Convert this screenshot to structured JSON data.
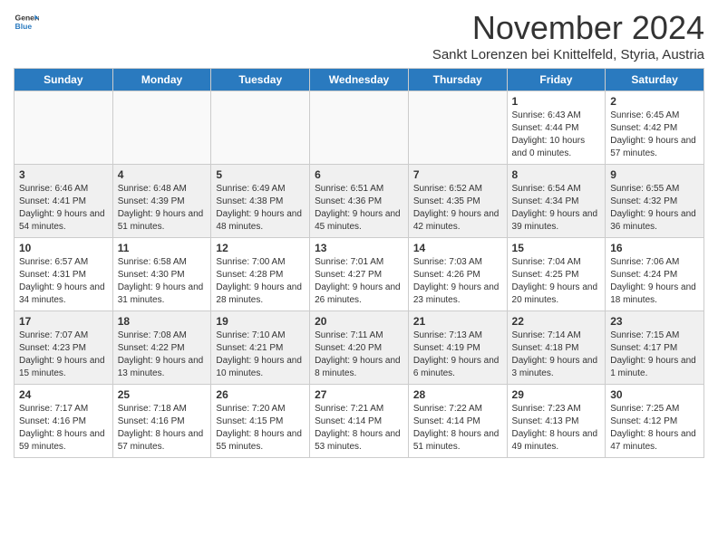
{
  "header": {
    "logo_line1": "General",
    "logo_line2": "Blue",
    "month_title": "November 2024",
    "location": "Sankt Lorenzen bei Knittelfeld, Styria, Austria"
  },
  "days_of_week": [
    "Sunday",
    "Monday",
    "Tuesday",
    "Wednesday",
    "Thursday",
    "Friday",
    "Saturday"
  ],
  "weeks": [
    [
      {
        "day": "",
        "info": ""
      },
      {
        "day": "",
        "info": ""
      },
      {
        "day": "",
        "info": ""
      },
      {
        "day": "",
        "info": ""
      },
      {
        "day": "",
        "info": ""
      },
      {
        "day": "1",
        "info": "Sunrise: 6:43 AM\nSunset: 4:44 PM\nDaylight: 10 hours and 0 minutes."
      },
      {
        "day": "2",
        "info": "Sunrise: 6:45 AM\nSunset: 4:42 PM\nDaylight: 9 hours and 57 minutes."
      }
    ],
    [
      {
        "day": "3",
        "info": "Sunrise: 6:46 AM\nSunset: 4:41 PM\nDaylight: 9 hours and 54 minutes."
      },
      {
        "day": "4",
        "info": "Sunrise: 6:48 AM\nSunset: 4:39 PM\nDaylight: 9 hours and 51 minutes."
      },
      {
        "day": "5",
        "info": "Sunrise: 6:49 AM\nSunset: 4:38 PM\nDaylight: 9 hours and 48 minutes."
      },
      {
        "day": "6",
        "info": "Sunrise: 6:51 AM\nSunset: 4:36 PM\nDaylight: 9 hours and 45 minutes."
      },
      {
        "day": "7",
        "info": "Sunrise: 6:52 AM\nSunset: 4:35 PM\nDaylight: 9 hours and 42 minutes."
      },
      {
        "day": "8",
        "info": "Sunrise: 6:54 AM\nSunset: 4:34 PM\nDaylight: 9 hours and 39 minutes."
      },
      {
        "day": "9",
        "info": "Sunrise: 6:55 AM\nSunset: 4:32 PM\nDaylight: 9 hours and 36 minutes."
      }
    ],
    [
      {
        "day": "10",
        "info": "Sunrise: 6:57 AM\nSunset: 4:31 PM\nDaylight: 9 hours and 34 minutes."
      },
      {
        "day": "11",
        "info": "Sunrise: 6:58 AM\nSunset: 4:30 PM\nDaylight: 9 hours and 31 minutes."
      },
      {
        "day": "12",
        "info": "Sunrise: 7:00 AM\nSunset: 4:28 PM\nDaylight: 9 hours and 28 minutes."
      },
      {
        "day": "13",
        "info": "Sunrise: 7:01 AM\nSunset: 4:27 PM\nDaylight: 9 hours and 26 minutes."
      },
      {
        "day": "14",
        "info": "Sunrise: 7:03 AM\nSunset: 4:26 PM\nDaylight: 9 hours and 23 minutes."
      },
      {
        "day": "15",
        "info": "Sunrise: 7:04 AM\nSunset: 4:25 PM\nDaylight: 9 hours and 20 minutes."
      },
      {
        "day": "16",
        "info": "Sunrise: 7:06 AM\nSunset: 4:24 PM\nDaylight: 9 hours and 18 minutes."
      }
    ],
    [
      {
        "day": "17",
        "info": "Sunrise: 7:07 AM\nSunset: 4:23 PM\nDaylight: 9 hours and 15 minutes."
      },
      {
        "day": "18",
        "info": "Sunrise: 7:08 AM\nSunset: 4:22 PM\nDaylight: 9 hours and 13 minutes."
      },
      {
        "day": "19",
        "info": "Sunrise: 7:10 AM\nSunset: 4:21 PM\nDaylight: 9 hours and 10 minutes."
      },
      {
        "day": "20",
        "info": "Sunrise: 7:11 AM\nSunset: 4:20 PM\nDaylight: 9 hours and 8 minutes."
      },
      {
        "day": "21",
        "info": "Sunrise: 7:13 AM\nSunset: 4:19 PM\nDaylight: 9 hours and 6 minutes."
      },
      {
        "day": "22",
        "info": "Sunrise: 7:14 AM\nSunset: 4:18 PM\nDaylight: 9 hours and 3 minutes."
      },
      {
        "day": "23",
        "info": "Sunrise: 7:15 AM\nSunset: 4:17 PM\nDaylight: 9 hours and 1 minute."
      }
    ],
    [
      {
        "day": "24",
        "info": "Sunrise: 7:17 AM\nSunset: 4:16 PM\nDaylight: 8 hours and 59 minutes."
      },
      {
        "day": "25",
        "info": "Sunrise: 7:18 AM\nSunset: 4:16 PM\nDaylight: 8 hours and 57 minutes."
      },
      {
        "day": "26",
        "info": "Sunrise: 7:20 AM\nSunset: 4:15 PM\nDaylight: 8 hours and 55 minutes."
      },
      {
        "day": "27",
        "info": "Sunrise: 7:21 AM\nSunset: 4:14 PM\nDaylight: 8 hours and 53 minutes."
      },
      {
        "day": "28",
        "info": "Sunrise: 7:22 AM\nSunset: 4:14 PM\nDaylight: 8 hours and 51 minutes."
      },
      {
        "day": "29",
        "info": "Sunrise: 7:23 AM\nSunset: 4:13 PM\nDaylight: 8 hours and 49 minutes."
      },
      {
        "day": "30",
        "info": "Sunrise: 7:25 AM\nSunset: 4:12 PM\nDaylight: 8 hours and 47 minutes."
      }
    ]
  ]
}
